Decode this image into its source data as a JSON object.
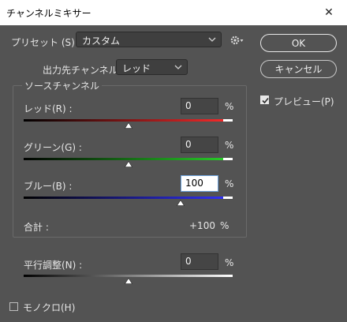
{
  "window": {
    "title": "チャンネルミキサー",
    "close_glyph": "✕"
  },
  "preset": {
    "label": "プリセット (S) :",
    "value": "カスタム"
  },
  "output_channel": {
    "label": "出力先チャンネル :",
    "value": "レッド"
  },
  "source_group": {
    "title": "ソースチャンネル",
    "red": {
      "label": "レッド(R) :",
      "value": "0",
      "unit": "%",
      "level": 0.5
    },
    "green": {
      "label": "グリーン(G) :",
      "value": "0",
      "unit": "%",
      "level": 0.5
    },
    "blue": {
      "label": "ブルー(B) :",
      "value": "100",
      "unit": "%",
      "level": 0.75
    },
    "total": {
      "label": "合計 :",
      "value": "+100",
      "unit": "%"
    }
  },
  "constant": {
    "label": "平行調整(N) :",
    "value": "0",
    "unit": "%",
    "level": 0.5
  },
  "monochrome": {
    "label": "モノクロ(H)",
    "checked": false
  },
  "buttons": {
    "ok": "OK",
    "cancel": "キャンセル"
  },
  "preview": {
    "label": "プレビュー(P)",
    "checked": true
  },
  "icons": {
    "settings": "gear-icon",
    "dropdown": "chevron-down-icon",
    "thumb": "slider-thumb-icon"
  }
}
